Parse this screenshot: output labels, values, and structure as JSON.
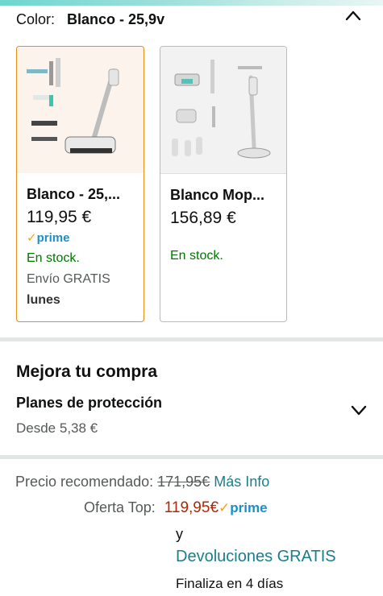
{
  "color_selector": {
    "label": "Color:",
    "value": "Blanco - 25,9v"
  },
  "variants": [
    {
      "name": "Blanco - 25,...",
      "price": "119,95 €",
      "prime": "prime",
      "stock": "En stock.",
      "shipping": "Envío GRATIS",
      "delivery_day": "lunes",
      "selected": true
    },
    {
      "name": "Blanco Mop...",
      "price": "156,89 €",
      "stock": "En stock.",
      "selected": false
    }
  ],
  "upgrade": {
    "title": "Mejora tu compra",
    "protection_title": "Planes de protección",
    "protection_from": "Desde 5,38 €"
  },
  "pricing": {
    "recommended_label": "Precio recomendado:",
    "recommended_value": "171,95€",
    "more_info": "Más Info",
    "offer_label": "Oferta Top:",
    "offer_value": "119,95€",
    "prime": "prime",
    "and": "y",
    "returns": "Devoluciones GRATIS",
    "ends": "Finaliza en 4 días"
  },
  "colors": {
    "selected_border": "#e88b17",
    "prime_blue": "#1b8fc9",
    "stock_green": "#007600",
    "offer_red": "#b12704",
    "link_teal": "#1b7e8a"
  }
}
